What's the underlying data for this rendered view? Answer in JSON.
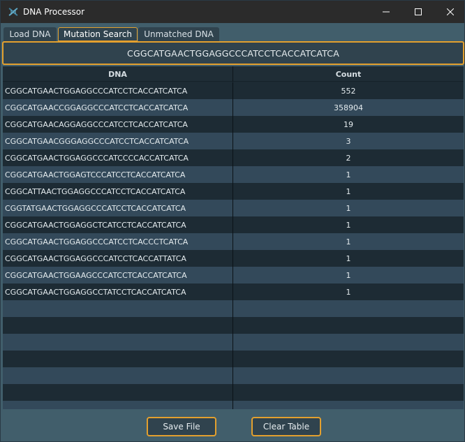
{
  "window": {
    "title": "DNA Processor",
    "minimize_glyph": "—",
    "maximize_glyph": "☐",
    "close_glyph": "✕"
  },
  "tabs": [
    {
      "label": "Load DNA",
      "active": false
    },
    {
      "label": "Mutation Search",
      "active": true
    },
    {
      "label": "Unmatched DNA",
      "active": false
    }
  ],
  "search": {
    "value": "CGGCATGAACTGGAGGCCCATCCTCACCATCATCA"
  },
  "table": {
    "headers": {
      "dna": "DNA",
      "count": "Count"
    },
    "rows": [
      {
        "dna": "CGGCATGAACTGGAGGCCCATCCTCACCATCATCA",
        "count": "552"
      },
      {
        "dna": "CGGCATGAACCGGAGGCCCATCCTCACCATCATCA",
        "count": "358904"
      },
      {
        "dna": "CGGCATGAACAGGAGGCCCATCCTCACCATCATCA",
        "count": "19"
      },
      {
        "dna": "CGGCATGAACGGGAGGCCCATCCTCACCATCATCA",
        "count": "3"
      },
      {
        "dna": "CGGCATGAACTGGAGGCCCATCCCCACCATCATCA",
        "count": "2"
      },
      {
        "dna": "CGGCATGAACTGGAGTCCCATCCTCACCATCATCA",
        "count": "1"
      },
      {
        "dna": "CGGCATTAACTGGAGGCCCATCCTCACCATCATCA",
        "count": "1"
      },
      {
        "dna": "CGGTATGAACTGGAGGCCCATCCTCACCATCATCA",
        "count": "1"
      },
      {
        "dna": "CGGCATGAACTGGAGGCTCATCCTCACCATCATCA",
        "count": "1"
      },
      {
        "dna": "CGGCATGAACTGGAGGCCCATCCTCACCCTCATCA",
        "count": "1"
      },
      {
        "dna": "CGGCATGAACTGGAGGCCCATCCTCACCATTATCA",
        "count": "1"
      },
      {
        "dna": "CGGCATGAACTGGAAGCCCATCCTCACCATCATCA",
        "count": "1"
      },
      {
        "dna": "CGGCATGAACTGGAGGCCTATCCTCACCATCATCA",
        "count": "1"
      }
    ]
  },
  "buttons": {
    "save": "Save File",
    "clear": "Clear Table"
  },
  "colors": {
    "accent": "#e3a02e",
    "background": "#415e6b",
    "titlebar": "#2b2b2b"
  }
}
